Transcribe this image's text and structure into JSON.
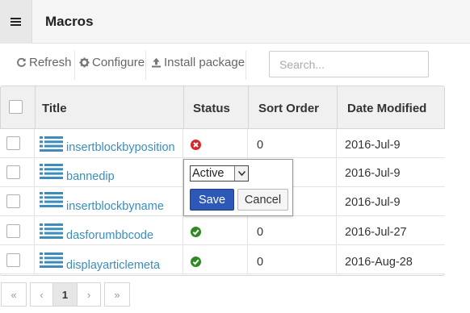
{
  "header": {
    "title": "Macros",
    "menu_icon": "hamburger-menu-icon"
  },
  "toolbar": {
    "refresh_label": "Refresh",
    "configure_label": "Configure",
    "install_label": "Install package",
    "search_placeholder": "Search..."
  },
  "table": {
    "columns": [
      "Title",
      "Status",
      "Sort Order",
      "Date Modified"
    ],
    "rows": [
      {
        "title": "insertblockbyposition",
        "status": "inactive",
        "sort_order": "0",
        "date_modified": "2016-Jul-9"
      },
      {
        "title": "bannedip",
        "status": "editing",
        "sort_order": "",
        "date_modified": "2016-Jul-9"
      },
      {
        "title": "insertblockbyname",
        "status": "editing",
        "sort_order": "",
        "date_modified": "2016-Jul-9"
      },
      {
        "title": "dasforumbbcode",
        "status": "active",
        "sort_order": "0",
        "date_modified": "2016-Jul-27"
      },
      {
        "title": "displayarticlemeta",
        "status": "active",
        "sort_order": "0",
        "date_modified": "2016-Aug-28"
      }
    ]
  },
  "popover": {
    "selected_value": "Active",
    "save_label": "Save",
    "cancel_label": "Cancel"
  },
  "pagination": {
    "first": "«",
    "prev": "‹",
    "current": "1",
    "next": "›",
    "last": "»"
  },
  "colors": {
    "link": "#3a8dbd",
    "status_inactive": "#d9262b",
    "status_active": "#2f8a22",
    "save_button": "#2e58b8"
  }
}
